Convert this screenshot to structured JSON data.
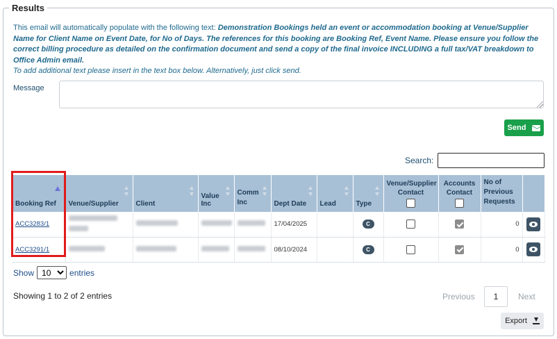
{
  "section": {
    "legend": "Results"
  },
  "info": {
    "lead": "This email will automatically populate with the following text: ",
    "template": "Demonstration Bookings held an event or accommodation booking at Venue/Supplier Name for Client Name on Event Date, for No of Days. The references for this booking are Booking Ref, Event Name. Please ensure you follow the correct billing procedure as detailed on the confirmation document and send a copy of the final invoice INCLUDING a full tax/VAT breakdown to Office Admin email.",
    "hint": "To add additional text please insert in the text box below. Alternatively, just click send."
  },
  "message": {
    "label": "Message",
    "value": ""
  },
  "send": {
    "label": "Send",
    "icon": "envelope-icon"
  },
  "search": {
    "label": "Search:",
    "value": ""
  },
  "table": {
    "columns": {
      "booking_ref": "Booking Ref",
      "venue": "Venue/Supplier",
      "client": "Client",
      "value_inc": "Value Inc",
      "comm_inc": "Comm Inc",
      "dept_date": "Dept Date",
      "lead": "Lead",
      "type": "Type",
      "venue_contact": "Venue/Supplier Contact",
      "accounts_contact": "Accounts Contact",
      "prev_requests": "No of Previous Requests"
    },
    "rows": [
      {
        "booking_ref": "ACC3283/1",
        "dept_date": "17/04/2025",
        "type": "C",
        "venue_contact": false,
        "accounts_contact": true,
        "prev_requests": "0"
      },
      {
        "booking_ref": "ACC3291/1",
        "dept_date": "08/10/2024",
        "type": "C",
        "venue_contact": false,
        "accounts_contact": true,
        "prev_requests": "0"
      }
    ]
  },
  "length": {
    "show": "Show",
    "value": "10",
    "entries": "entries"
  },
  "summary": "Showing 1 to 2 of 2 entries",
  "pagination": {
    "previous": "Previous",
    "current": "1",
    "next": "Next"
  },
  "export": {
    "label": "Export"
  },
  "colors": {
    "header": "#a8c0d6",
    "send": "#1aa04a",
    "highlight": "#e01b1b",
    "info_text": "#1f6a8e"
  }
}
